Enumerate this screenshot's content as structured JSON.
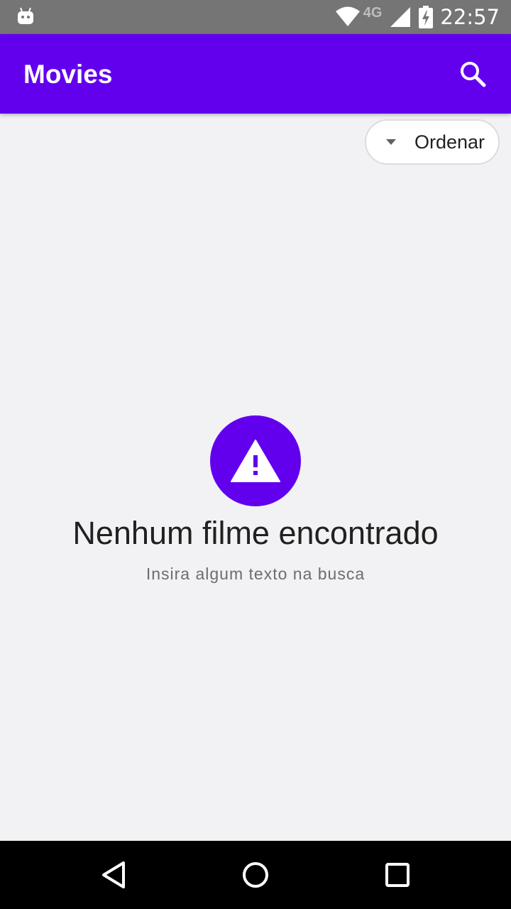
{
  "status_bar": {
    "time": "22:57",
    "network": "4G",
    "icons": [
      "android-debug-icon",
      "wifi-icon",
      "signal-icon",
      "battery-charging-icon"
    ]
  },
  "app_bar": {
    "title": "Movies",
    "search_icon": "search-icon",
    "color": "#6200ee"
  },
  "sort": {
    "label": "Ordenar",
    "icon": "dropdown-arrow-icon"
  },
  "empty_state": {
    "icon": "warning-icon",
    "title": "Nenhum filme encontrado",
    "subtitle": "Insira algum texto na busca"
  },
  "nav_bar": {
    "icons": [
      "back-icon",
      "home-icon",
      "recents-icon"
    ]
  }
}
